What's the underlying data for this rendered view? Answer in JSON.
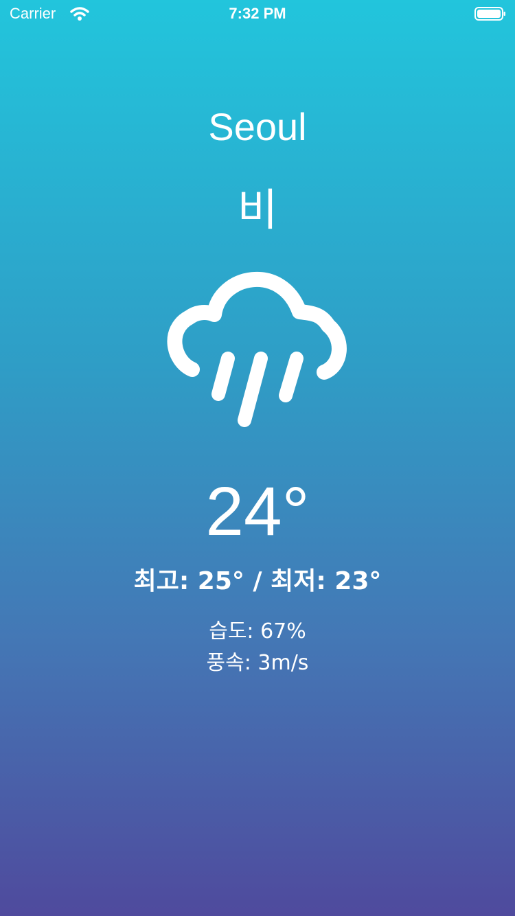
{
  "status_bar": {
    "carrier": "Carrier",
    "time": "7:32 PM",
    "wifi_icon": "wifi-icon",
    "battery_icon": "battery-icon"
  },
  "weather": {
    "city": "Seoul",
    "condition": "비",
    "icon": "rain-cloud-icon",
    "temperature": "24°",
    "high_low": "최고: 25° / 최저: 23°",
    "humidity": "습도: 67%",
    "wind": "풍속: 3m/s"
  },
  "colors": {
    "gradient_top": "#22c5dc",
    "gradient_bottom": "#4f4a9d",
    "text": "#ffffff"
  }
}
